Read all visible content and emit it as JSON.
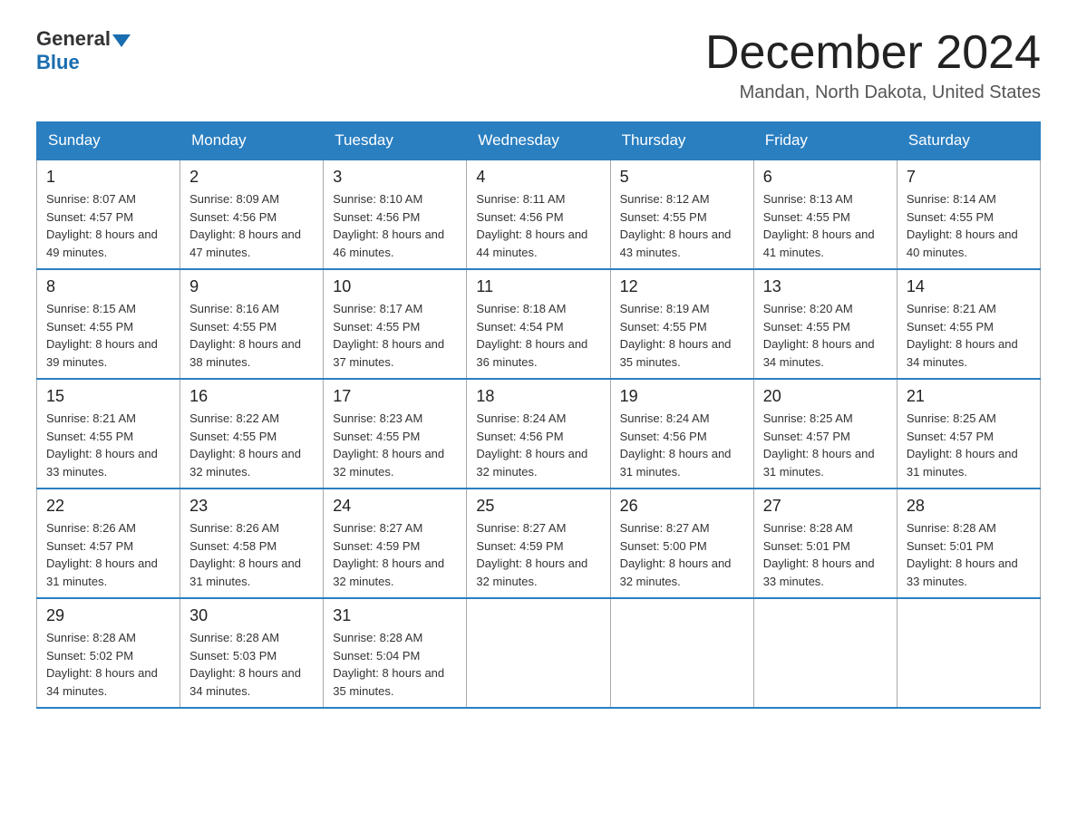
{
  "header": {
    "logo_general": "General",
    "logo_blue": "Blue",
    "month_title": "December 2024",
    "location": "Mandan, North Dakota, United States"
  },
  "weekdays": [
    "Sunday",
    "Monday",
    "Tuesday",
    "Wednesday",
    "Thursday",
    "Friday",
    "Saturday"
  ],
  "weeks": [
    [
      {
        "day": "1",
        "sunrise": "8:07 AM",
        "sunset": "4:57 PM",
        "daylight": "8 hours and 49 minutes."
      },
      {
        "day": "2",
        "sunrise": "8:09 AM",
        "sunset": "4:56 PM",
        "daylight": "8 hours and 47 minutes."
      },
      {
        "day": "3",
        "sunrise": "8:10 AM",
        "sunset": "4:56 PM",
        "daylight": "8 hours and 46 minutes."
      },
      {
        "day": "4",
        "sunrise": "8:11 AM",
        "sunset": "4:56 PM",
        "daylight": "8 hours and 44 minutes."
      },
      {
        "day": "5",
        "sunrise": "8:12 AM",
        "sunset": "4:55 PM",
        "daylight": "8 hours and 43 minutes."
      },
      {
        "day": "6",
        "sunrise": "8:13 AM",
        "sunset": "4:55 PM",
        "daylight": "8 hours and 41 minutes."
      },
      {
        "day": "7",
        "sunrise": "8:14 AM",
        "sunset": "4:55 PM",
        "daylight": "8 hours and 40 minutes."
      }
    ],
    [
      {
        "day": "8",
        "sunrise": "8:15 AM",
        "sunset": "4:55 PM",
        "daylight": "8 hours and 39 minutes."
      },
      {
        "day": "9",
        "sunrise": "8:16 AM",
        "sunset": "4:55 PM",
        "daylight": "8 hours and 38 minutes."
      },
      {
        "day": "10",
        "sunrise": "8:17 AM",
        "sunset": "4:55 PM",
        "daylight": "8 hours and 37 minutes."
      },
      {
        "day": "11",
        "sunrise": "8:18 AM",
        "sunset": "4:54 PM",
        "daylight": "8 hours and 36 minutes."
      },
      {
        "day": "12",
        "sunrise": "8:19 AM",
        "sunset": "4:55 PM",
        "daylight": "8 hours and 35 minutes."
      },
      {
        "day": "13",
        "sunrise": "8:20 AM",
        "sunset": "4:55 PM",
        "daylight": "8 hours and 34 minutes."
      },
      {
        "day": "14",
        "sunrise": "8:21 AM",
        "sunset": "4:55 PM",
        "daylight": "8 hours and 34 minutes."
      }
    ],
    [
      {
        "day": "15",
        "sunrise": "8:21 AM",
        "sunset": "4:55 PM",
        "daylight": "8 hours and 33 minutes."
      },
      {
        "day": "16",
        "sunrise": "8:22 AM",
        "sunset": "4:55 PM",
        "daylight": "8 hours and 32 minutes."
      },
      {
        "day": "17",
        "sunrise": "8:23 AM",
        "sunset": "4:55 PM",
        "daylight": "8 hours and 32 minutes."
      },
      {
        "day": "18",
        "sunrise": "8:24 AM",
        "sunset": "4:56 PM",
        "daylight": "8 hours and 32 minutes."
      },
      {
        "day": "19",
        "sunrise": "8:24 AM",
        "sunset": "4:56 PM",
        "daylight": "8 hours and 31 minutes."
      },
      {
        "day": "20",
        "sunrise": "8:25 AM",
        "sunset": "4:57 PM",
        "daylight": "8 hours and 31 minutes."
      },
      {
        "day": "21",
        "sunrise": "8:25 AM",
        "sunset": "4:57 PM",
        "daylight": "8 hours and 31 minutes."
      }
    ],
    [
      {
        "day": "22",
        "sunrise": "8:26 AM",
        "sunset": "4:57 PM",
        "daylight": "8 hours and 31 minutes."
      },
      {
        "day": "23",
        "sunrise": "8:26 AM",
        "sunset": "4:58 PM",
        "daylight": "8 hours and 31 minutes."
      },
      {
        "day": "24",
        "sunrise": "8:27 AM",
        "sunset": "4:59 PM",
        "daylight": "8 hours and 32 minutes."
      },
      {
        "day": "25",
        "sunrise": "8:27 AM",
        "sunset": "4:59 PM",
        "daylight": "8 hours and 32 minutes."
      },
      {
        "day": "26",
        "sunrise": "8:27 AM",
        "sunset": "5:00 PM",
        "daylight": "8 hours and 32 minutes."
      },
      {
        "day": "27",
        "sunrise": "8:28 AM",
        "sunset": "5:01 PM",
        "daylight": "8 hours and 33 minutes."
      },
      {
        "day": "28",
        "sunrise": "8:28 AM",
        "sunset": "5:01 PM",
        "daylight": "8 hours and 33 minutes."
      }
    ],
    [
      {
        "day": "29",
        "sunrise": "8:28 AM",
        "sunset": "5:02 PM",
        "daylight": "8 hours and 34 minutes."
      },
      {
        "day": "30",
        "sunrise": "8:28 AM",
        "sunset": "5:03 PM",
        "daylight": "8 hours and 34 minutes."
      },
      {
        "day": "31",
        "sunrise": "8:28 AM",
        "sunset": "5:04 PM",
        "daylight": "8 hours and 35 minutes."
      },
      null,
      null,
      null,
      null
    ]
  ]
}
